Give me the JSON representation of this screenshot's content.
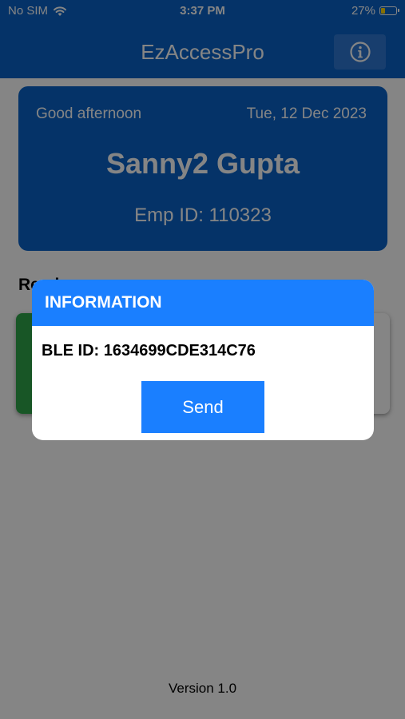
{
  "status_bar": {
    "carrier": "No SIM",
    "time": "3:37 PM",
    "battery_percent": "27%",
    "battery_level": 0.27,
    "battery_color": "#ffd60a"
  },
  "header": {
    "title": "EzAccessPro",
    "info_icon": "info-circle-icon"
  },
  "employee_card": {
    "greeting": "Good afternoon",
    "date": "Tue, 12 Dec 2023",
    "name": "Sanny2 Gupta",
    "emp_id": "Emp ID: 110323"
  },
  "main": {
    "section_heading": "Readers",
    "reader_status_color": "#2ea54a"
  },
  "dialog": {
    "title": "INFORMATION",
    "body": "BLE ID: 1634699CDE314C76",
    "send_label": "Send"
  },
  "footer": {
    "version": "Version 1.0"
  },
  "colors": {
    "brand": "#0a63c8",
    "accent": "#1a7fff"
  }
}
